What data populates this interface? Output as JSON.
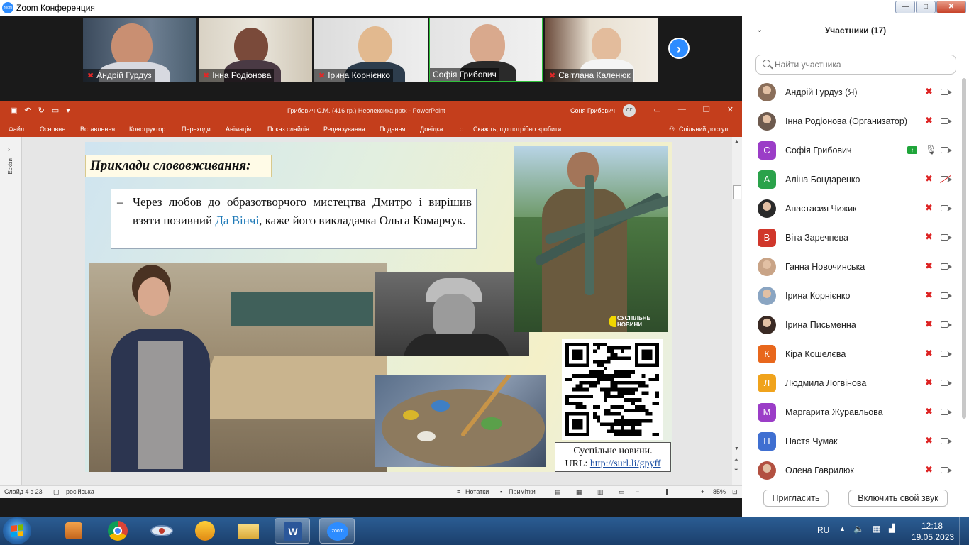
{
  "window": {
    "title": "Zoom Конференция",
    "logo_text": "zoom"
  },
  "window_controls": {
    "minimize": "—",
    "maximize": "□",
    "close": "✕"
  },
  "videos": [
    {
      "name": "Андрій Гурдуз",
      "muted": true
    },
    {
      "name": "Інна Родіонова",
      "muted": true
    },
    {
      "name": "Ірина Корнієнко",
      "muted": true
    },
    {
      "name": "Софія Грибович",
      "muted": false
    },
    {
      "name": "Світлана Каленюк",
      "muted": true
    }
  ],
  "next_arrow": "›",
  "ppt": {
    "doc_title": "Грибович С.М. (416 гр.) Неолексика.pptx  -  PowerPoint",
    "user": "Соня Грибович",
    "user_initials": "СГ",
    "menu": [
      "Файл",
      "Основне",
      "Вставлення",
      "Конструктор",
      "Переходи",
      "Анімація",
      "Показ слайдів",
      "Рецензування",
      "Подання",
      "Довідка"
    ],
    "tell_me": "Скажіть, що потрібно зробити",
    "share": "Спільний доступ",
    "sidebar_label": "Ескізи",
    "status": {
      "slide": "Слайд 4 з 23",
      "language": "російська",
      "notes": "Нотатки",
      "comments": "Примітки",
      "zoom": "85%"
    }
  },
  "slide": {
    "heading": "Приклади слововживання:",
    "quote_dash": "–",
    "quote_before": "Через любов до образотворчого мистецтва Дмитро і вирішив взяти позивний ",
    "quote_highlight": "Да Вінчі",
    "quote_after": ", каже його викладачка Ольга Комарчук.",
    "brand_line1": "СУСПІЛЬНЕ",
    "brand_line2": "НОВИНИ",
    "caption_line1": "Суспільне новини.",
    "caption_url_label": "URL:",
    "caption_url": "http://surl.li/gpyff"
  },
  "participants": {
    "header": "Участники (17)",
    "search_placeholder": "Найти участника",
    "list": [
      {
        "name": "Андрій Гурдуз (Я)",
        "initial": "",
        "color": "#8a6e5a",
        "photo": true,
        "mic": "muted",
        "cam": "on"
      },
      {
        "name": "Інна Родіонова (Организатор)",
        "initial": "",
        "color": "#6d5a4e",
        "photo": true,
        "mic": "muted",
        "cam": "on"
      },
      {
        "name": "Софія Грибович",
        "initial": "С",
        "color": "#9b3dc7",
        "photo": false,
        "mic": "on",
        "cam": "on",
        "sharing": true
      },
      {
        "name": "Аліна Бондаренко",
        "initial": "А",
        "color": "#2aa24a",
        "photo": false,
        "mic": "muted",
        "cam": "off"
      },
      {
        "name": "Анастасия Чижик",
        "initial": "",
        "color": "#2a2a2a",
        "photo": true,
        "mic": "muted",
        "cam": "on"
      },
      {
        "name": "Віта Заречнева",
        "initial": "В",
        "color": "#d0372b",
        "photo": false,
        "mic": "muted",
        "cam": "on"
      },
      {
        "name": "Ганна Новочинська",
        "initial": "",
        "color": "#c9a487",
        "photo": true,
        "mic": "muted",
        "cam": "on"
      },
      {
        "name": "Ірина Корнієнко",
        "initial": "",
        "color": "#8aa5c2",
        "photo": true,
        "mic": "muted",
        "cam": "on"
      },
      {
        "name": "Ірина Письменна",
        "initial": "",
        "color": "#3a2a24",
        "photo": true,
        "mic": "muted",
        "cam": "on"
      },
      {
        "name": "Кіра Кошелєва",
        "initial": "К",
        "color": "#e8671c",
        "photo": false,
        "mic": "muted",
        "cam": "on"
      },
      {
        "name": "Людмила Логвінова",
        "initial": "Л",
        "color": "#f0a31c",
        "photo": false,
        "mic": "muted",
        "cam": "on"
      },
      {
        "name": "Маргарита Журавльова",
        "initial": "М",
        "color": "#9b3dc7",
        "photo": false,
        "mic": "muted",
        "cam": "on"
      },
      {
        "name": "Настя Чумак",
        "initial": "Н",
        "color": "#3f6fd1",
        "photo": false,
        "mic": "muted",
        "cam": "on"
      },
      {
        "name": "Олена Гаврилюк",
        "initial": "",
        "color": "#b25040",
        "photo": true,
        "mic": "muted",
        "cam": "on"
      }
    ],
    "invite_button": "Пригласить",
    "unmute_button": "Включить свой звук"
  },
  "taskbar": {
    "language": "RU",
    "time": "12:18",
    "date": "19.05.2023"
  }
}
